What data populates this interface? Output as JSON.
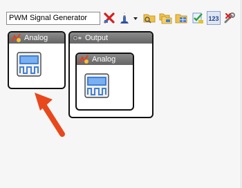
{
  "toolbar": {
    "name_value": "PWM Signal Generator",
    "icons": [
      "delete-icon",
      "probe-tool-icon",
      "dropdown-chevron-icon",
      "folder-open-icon",
      "folder-copy-icon",
      "folder-grid-icon",
      "check-list-icon",
      "numbers-icon",
      "wrench-x-icon"
    ]
  },
  "canvas": {
    "analog_panel": {
      "title": "Analog",
      "icon": "analog-header-icon",
      "module_icon": "analog-module-icon"
    },
    "output_panel": {
      "title": "Output",
      "icon": "output-header-icon",
      "inner_panel": {
        "title": "Analog",
        "icon": "analog-header-icon",
        "module_icon": "analog-module-icon"
      }
    },
    "annotation": "red-arrow-pointing-up"
  },
  "colors": {
    "panel_header": "#707070",
    "panel_border": "#111111",
    "arrow": "#e8481c",
    "module_blue": "#3f7fd6"
  }
}
